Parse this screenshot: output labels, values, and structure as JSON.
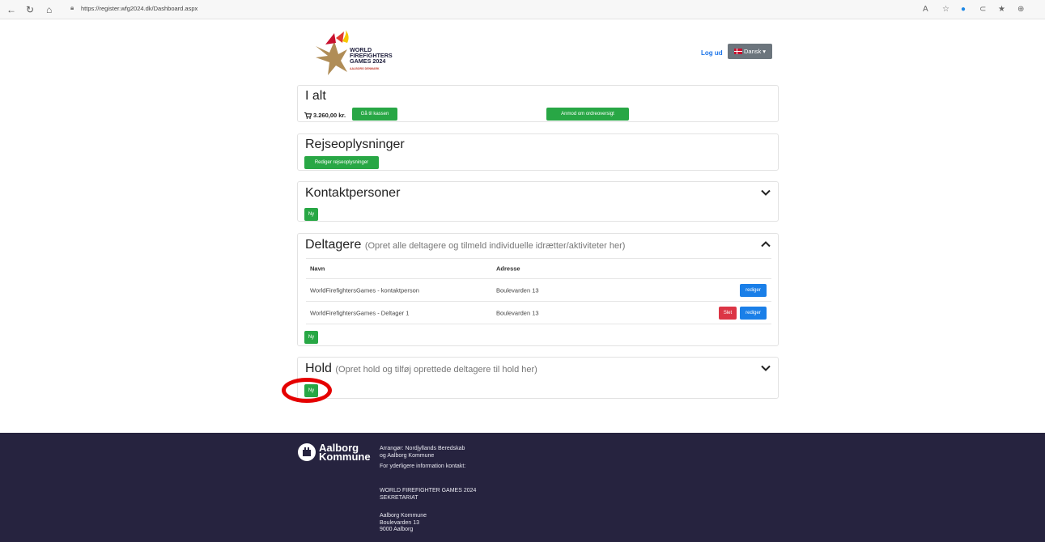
{
  "browser": {
    "url": "https://register.wfg2024.dk/Dashboard.aspx",
    "nav_icons": [
      "back-icon",
      "refresh-icon",
      "home-icon"
    ],
    "right_icons": [
      "read-aloud-icon",
      "favorites-add-icon",
      "extension-icon",
      "collections-icon",
      "favorites-icon",
      "more-icon"
    ]
  },
  "header": {
    "logo_line1": "WORLD",
    "logo_line2": "FIREFIGHTERS",
    "logo_line3": "GAMES 2024",
    "logo_sub": "AALBORG DENMARK",
    "logout": "Log ud",
    "language": "Dansk",
    "language_caret": "▾"
  },
  "total": {
    "title": "I alt",
    "amount": "3.260,00 kr.",
    "checkout": "Gå til kassen",
    "order_overview": "Anmod om ordreoversigt"
  },
  "travel": {
    "title": "Rejseoplysninger",
    "edit": "Rediger rejseoplysninger"
  },
  "contacts": {
    "title": "Kontaktpersoner",
    "new": "Ny"
  },
  "participants": {
    "title": "Deltagere",
    "subtitle": "(Opret alle deltagere og tilmeld individuelle idrætter/aktiviteter her)",
    "col_name": "Navn",
    "col_address": "Adresse",
    "rows": [
      {
        "name": "WorldFirefightersGames - kontaktperson",
        "address": "Boulevarden 13",
        "edit": "rediger"
      },
      {
        "name": "WorldFirefightersGames - Deltager 1",
        "address": "Boulevarden 13",
        "delete": "Slet",
        "edit": "rediger"
      }
    ],
    "new": "Ny"
  },
  "teams": {
    "title": "Hold",
    "subtitle": "(Opret hold og tilføj oprettede deltagere til hold her)",
    "new": "Ny"
  },
  "footer": {
    "logo_line1": "Aalborg",
    "logo_line2": "Kommune",
    "organizer_line1": "Arrangør: Nordjyllands Beredskab",
    "organizer_line2": "og Aalborg Kommune",
    "more_info": "For yderligere information kontakt:",
    "secretariat_line1": "WORLD FIREFIGHTER GAMES 2024",
    "secretariat_line2": "SEKRETARIAT",
    "address_line1": "Aalborg Kommune",
    "address_line2": "Boulevarden 13",
    "address_line3": "9000 Aalborg"
  },
  "colors": {
    "green": "#28a745",
    "blue": "#1a7fe8",
    "red": "#dc3545",
    "footer_bg": "#26233f",
    "highlight": "#e50000"
  }
}
